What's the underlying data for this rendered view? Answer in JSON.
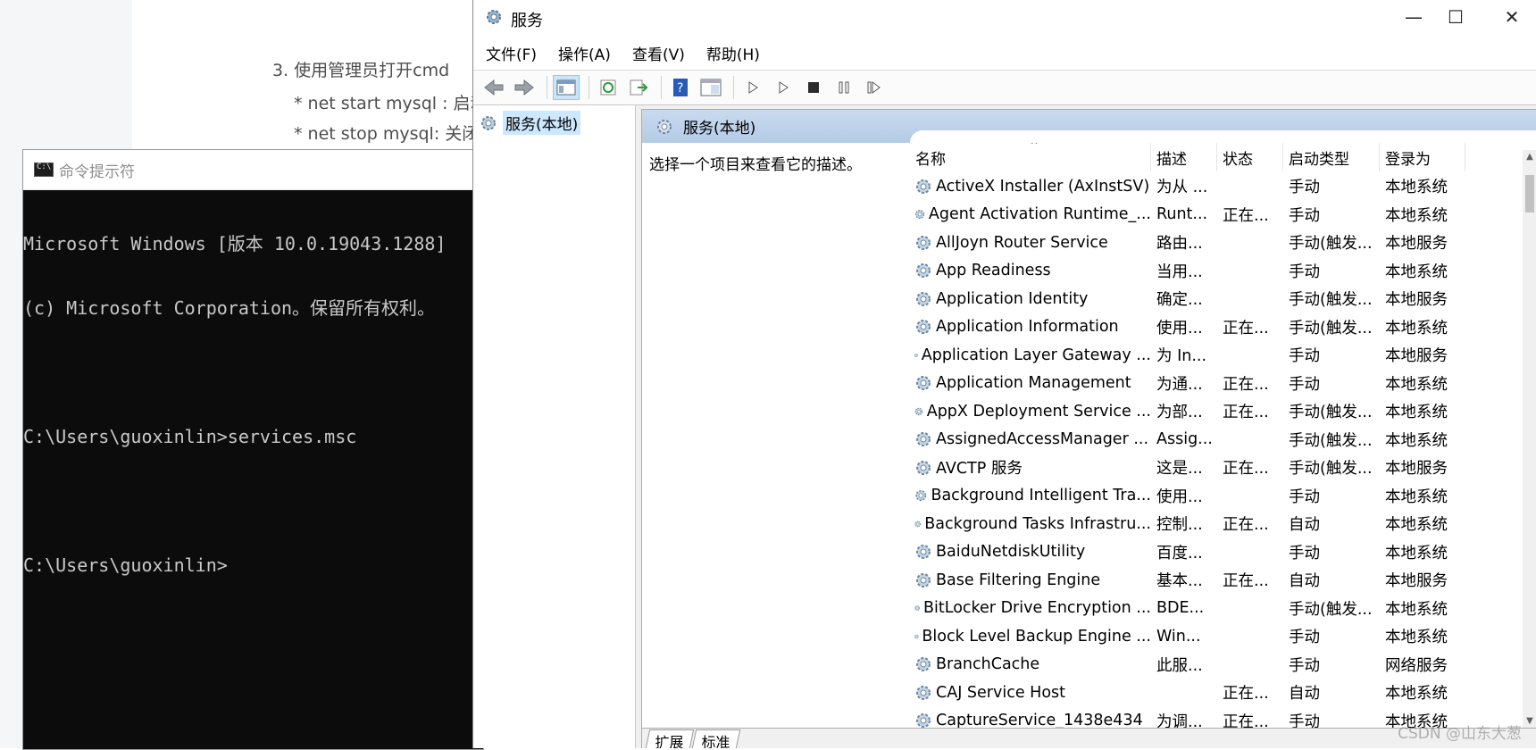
{
  "doc": {
    "step": "3. 使用管理员打开cmd",
    "bullet1": "* net start mysql : 启动",
    "bullet2": "* net stop mysql: 关闭"
  },
  "cmd": {
    "title": "命令提示符",
    "lines": [
      "Microsoft Windows [版本 10.0.19043.1288]",
      "(c) Microsoft Corporation。保留所有权利。",
      "",
      "C:\\Users\\guoxinlin>services.msc",
      "",
      "C:\\Users\\guoxinlin>"
    ]
  },
  "services_window": {
    "title": "服务",
    "minimize": "—",
    "maximize": "☐",
    "close": "✕",
    "menu": [
      "文件(F)",
      "操作(A)",
      "查看(V)",
      "帮助(H)"
    ],
    "tree_item": "服务(本地)",
    "panel_title": "服务(本地)",
    "description_prompt": "选择一个项目来查看它的描述。",
    "columns": [
      "名称",
      "描述",
      "状态",
      "启动类型",
      "登录为"
    ],
    "rows": [
      [
        "ActiveX Installer (AxInstSV)",
        "为从 ...",
        "",
        "手动",
        "本地系统"
      ],
      [
        "Agent Activation Runtime_...",
        "Runt...",
        "正在...",
        "手动",
        "本地系统"
      ],
      [
        "AllJoyn Router Service",
        "路由...",
        "",
        "手动(触发...",
        "本地服务"
      ],
      [
        "App Readiness",
        "当用...",
        "",
        "手动",
        "本地系统"
      ],
      [
        "Application Identity",
        "确定...",
        "",
        "手动(触发...",
        "本地服务"
      ],
      [
        "Application Information",
        "使用...",
        "正在...",
        "手动(触发...",
        "本地系统"
      ],
      [
        "Application Layer Gateway ...",
        "为 In...",
        "",
        "手动",
        "本地服务"
      ],
      [
        "Application Management",
        "为通...",
        "正在...",
        "手动",
        "本地系统"
      ],
      [
        "AppX Deployment Service ...",
        "为部...",
        "正在...",
        "手动(触发...",
        "本地系统"
      ],
      [
        "AssignedAccessManager ...",
        "Assig...",
        "",
        "手动(触发...",
        "本地系统"
      ],
      [
        "AVCTP 服务",
        "这是...",
        "正在...",
        "手动(触发...",
        "本地服务"
      ],
      [
        "Background Intelligent Tra...",
        "使用...",
        "",
        "手动",
        "本地系统"
      ],
      [
        "Background Tasks Infrastru...",
        "控制...",
        "正在...",
        "自动",
        "本地系统"
      ],
      [
        "BaiduNetdiskUtility",
        "百度...",
        "",
        "手动",
        "本地系统"
      ],
      [
        "Base Filtering Engine",
        "基本...",
        "正在...",
        "自动",
        "本地服务"
      ],
      [
        "BitLocker Drive Encryption ...",
        "BDE...",
        "",
        "手动(触发...",
        "本地系统"
      ],
      [
        "Block Level Backup Engine ...",
        "Win...",
        "",
        "手动",
        "本地系统"
      ],
      [
        "BranchCache",
        "此服...",
        "",
        "手动",
        "网络服务"
      ],
      [
        "CAJ Service Host",
        "",
        "正在...",
        "自动",
        "本地系统"
      ],
      [
        "CaptureService_1438e434",
        "为调...",
        "正在...",
        "手动",
        "本地系统"
      ]
    ],
    "tabs": [
      "扩展",
      "标准"
    ]
  },
  "watermark": "CSDN @山东大葱"
}
